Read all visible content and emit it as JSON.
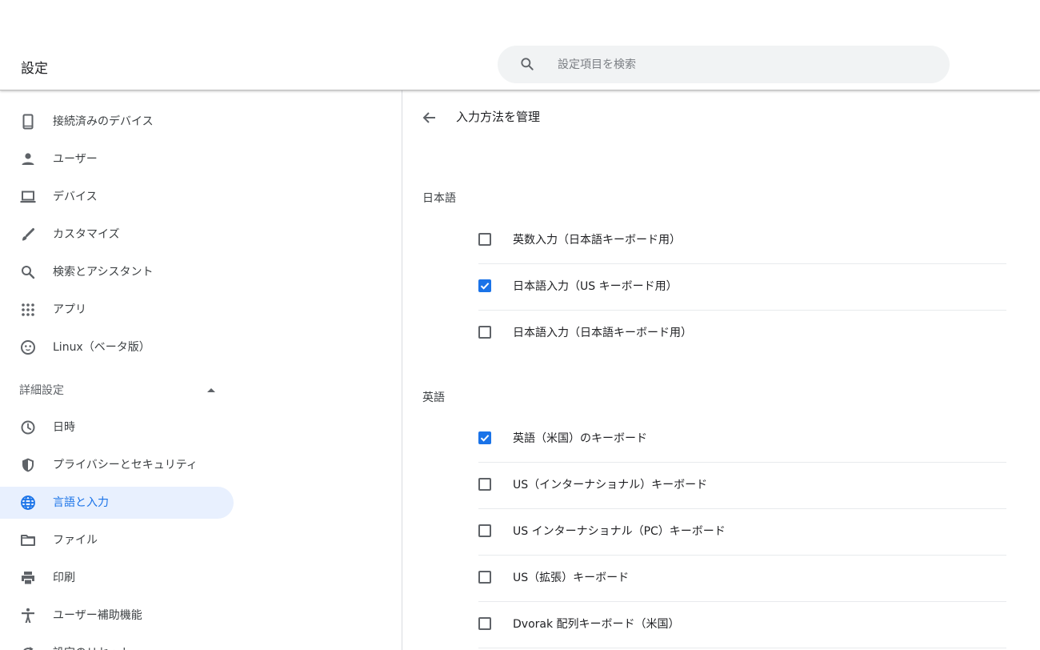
{
  "header": {
    "title": "設定",
    "search_placeholder": "設定項目を検索"
  },
  "sidebar": {
    "items": [
      {
        "label": "接続済みのデバイス",
        "icon": "phone-icon"
      },
      {
        "label": "ユーザー",
        "icon": "person-icon"
      },
      {
        "label": "デバイス",
        "icon": "laptop-icon"
      },
      {
        "label": "カスタマイズ",
        "icon": "brush-icon"
      },
      {
        "label": "検索とアシスタント",
        "icon": "search-icon"
      },
      {
        "label": "アプリ",
        "icon": "apps-grid-icon"
      },
      {
        "label": "Linux（ベータ版）",
        "icon": "penguin-icon"
      }
    ],
    "advanced_label": "詳細設定",
    "advanced_items": [
      {
        "label": "日時",
        "icon": "clock-icon"
      },
      {
        "label": "プライバシーとセキュリティ",
        "icon": "shield-icon"
      },
      {
        "label": "言語と入力",
        "icon": "globe-icon",
        "selected": true
      },
      {
        "label": "ファイル",
        "icon": "folder-icon"
      },
      {
        "label": "印刷",
        "icon": "printer-icon"
      },
      {
        "label": "ユーザー補助機能",
        "icon": "accessibility-icon"
      },
      {
        "label": "設定のリセット",
        "icon": "reset-icon"
      }
    ]
  },
  "main": {
    "title": "入力方法を管理",
    "groups": [
      {
        "title": "日本語",
        "items": [
          {
            "label": "英数入力（日本語キーボード用）",
            "checked": false
          },
          {
            "label": "日本語入力（US キーボード用）",
            "checked": true
          },
          {
            "label": "日本語入力（日本語キーボード用）",
            "checked": false
          }
        ]
      },
      {
        "title": "英語",
        "items": [
          {
            "label": "英語（米国）のキーボード",
            "checked": true
          },
          {
            "label": "US（インターナショナル）キーボード",
            "checked": false
          },
          {
            "label": "US インターナショナル（PC）キーボード",
            "checked": false
          },
          {
            "label": "US（拡張）キーボード",
            "checked": false
          },
          {
            "label": "Dvorak 配列キーボード（米国）",
            "checked": false
          }
        ]
      }
    ]
  },
  "colors": {
    "accent": "#1a73e8",
    "selected_bg": "#e8f0fe",
    "icon": "#5f6368"
  }
}
